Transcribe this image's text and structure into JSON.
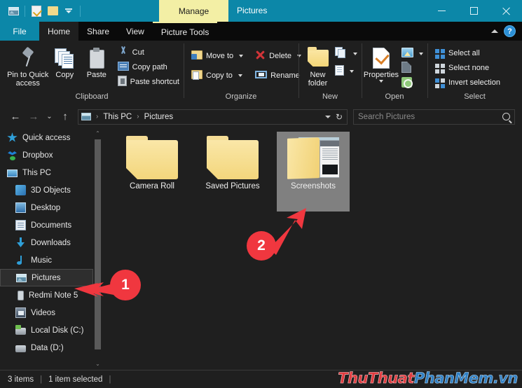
{
  "window": {
    "title": "Pictures",
    "contextual_tab": "Manage",
    "quick_access": [
      {
        "name": "pictures-icon",
        "tooltip": "Pictures"
      },
      {
        "name": "properties-icon",
        "tooltip": "Properties"
      },
      {
        "name": "new-folder-icon",
        "tooltip": "New folder"
      },
      {
        "name": "customize-dropdown-icon",
        "tooltip": "Customize Quick Access Toolbar"
      }
    ],
    "controls": {
      "minimize": "—",
      "maximize": "□",
      "close": "✕"
    },
    "accent_color": "#0c87a8",
    "contextual_color": "#f3efa5",
    "background": "#1f1f1f"
  },
  "tabs": [
    {
      "id": "file",
      "label": "File",
      "state": "file"
    },
    {
      "id": "home",
      "label": "Home",
      "state": "active"
    },
    {
      "id": "share",
      "label": "Share",
      "state": "normal"
    },
    {
      "id": "view",
      "label": "View",
      "state": "normal"
    },
    {
      "id": "picture-tools",
      "label": "Picture Tools",
      "state": "contextual"
    }
  ],
  "tab_strip_right": {
    "collapse_ribbon": "chevron-up-icon",
    "help_label": "?"
  },
  "ribbon": {
    "groups": [
      {
        "id": "clipboard",
        "label": "Clipboard",
        "big_buttons": [
          {
            "id": "pin-to-quick-access",
            "label": "Pin to Quick\naccess",
            "line1": "Pin to Quick",
            "line2": "access",
            "icon": "pin-icon"
          },
          {
            "id": "copy",
            "label": "Copy",
            "line1": "Copy",
            "line2": "",
            "icon": "copy-icon"
          },
          {
            "id": "paste",
            "label": "Paste",
            "line1": "Paste",
            "line2": "",
            "icon": "paste-icon"
          }
        ],
        "small_buttons": [
          {
            "id": "cut",
            "label": "Cut",
            "icon": "scissors-icon"
          },
          {
            "id": "copy-path",
            "label": "Copy path",
            "icon": "copy-path-icon"
          },
          {
            "id": "paste-shortcut",
            "label": "Paste shortcut",
            "icon": "paste-shortcut-icon"
          }
        ]
      },
      {
        "id": "organize",
        "label": "Organize",
        "small_buttons": [
          {
            "id": "move-to",
            "label": "Move to",
            "icon": "move-to-icon",
            "has_caret": true
          },
          {
            "id": "copy-to",
            "label": "Copy to",
            "icon": "copy-to-icon",
            "has_caret": true
          }
        ],
        "small_buttons_2": [
          {
            "id": "delete",
            "label": "Delete",
            "icon": "delete-icon",
            "has_caret": true
          },
          {
            "id": "rename",
            "label": "Rename",
            "icon": "rename-icon",
            "has_caret": false
          }
        ]
      },
      {
        "id": "new",
        "label": "New",
        "big_buttons": [
          {
            "id": "new-folder",
            "label": "New folder",
            "line1": "New",
            "line2": "folder",
            "icon": "new-folder-icon"
          }
        ],
        "small_buttons": [
          {
            "id": "new-item",
            "label": "",
            "icon": "new-item-icon",
            "has_caret": true
          },
          {
            "id": "easy-access",
            "label": "",
            "icon": "easy-access-icon",
            "has_caret": true
          }
        ]
      },
      {
        "id": "open",
        "label": "Open",
        "big_buttons": [
          {
            "id": "properties",
            "label": "Properties",
            "line1": "Properties",
            "line2": "",
            "icon": "properties-icon"
          }
        ],
        "small_buttons": [
          {
            "id": "open-with",
            "label": "",
            "icon": "open-icon",
            "has_caret": true
          },
          {
            "id": "edit",
            "label": "",
            "icon": "edit-icon",
            "has_caret": false
          },
          {
            "id": "history",
            "label": "",
            "icon": "history-icon",
            "has_caret": false
          }
        ]
      },
      {
        "id": "select",
        "label": "Select",
        "small_buttons": [
          {
            "id": "select-all",
            "label": "Select all",
            "icon": "select-all-icon"
          },
          {
            "id": "select-none",
            "label": "Select none",
            "icon": "select-none-icon"
          },
          {
            "id": "invert-selection",
            "label": "Invert selection",
            "icon": "invert-selection-icon"
          }
        ]
      }
    ]
  },
  "address_bar": {
    "back": "←",
    "forward": "→",
    "recent": "⌄",
    "up": "↑",
    "breadcrumbs": [
      {
        "id": "this-pc",
        "label": "This PC"
      },
      {
        "id": "pictures",
        "label": "Pictures"
      }
    ],
    "separator": "›",
    "refresh": "↻",
    "dropdown": "chevron-down-icon"
  },
  "search": {
    "placeholder": "Search Pictures",
    "value": "",
    "icon": "search-icon"
  },
  "nav_pane": {
    "items": [
      {
        "id": "quick-access",
        "label": "Quick access",
        "icon": "star-icon",
        "indent": false,
        "selected": false
      },
      {
        "id": "dropbox",
        "label": "Dropbox",
        "icon": "dropbox-icon",
        "indent": false,
        "selected": false
      },
      {
        "id": "this-pc",
        "label": "This PC",
        "icon": "computer-icon",
        "indent": false,
        "selected": false
      },
      {
        "id": "3d-objects",
        "label": "3D Objects",
        "icon": "3d-objects-icon",
        "indent": true,
        "selected": false
      },
      {
        "id": "desktop",
        "label": "Desktop",
        "icon": "desktop-icon",
        "indent": true,
        "selected": false
      },
      {
        "id": "documents",
        "label": "Documents",
        "icon": "documents-icon",
        "indent": true,
        "selected": false
      },
      {
        "id": "downloads",
        "label": "Downloads",
        "icon": "downloads-icon",
        "indent": true,
        "selected": false
      },
      {
        "id": "music",
        "label": "Music",
        "icon": "music-icon",
        "indent": true,
        "selected": false
      },
      {
        "id": "pictures",
        "label": "Pictures",
        "icon": "pictures-icon",
        "indent": true,
        "selected": true
      },
      {
        "id": "redmi-note-5",
        "label": "Redmi Note 5",
        "icon": "phone-icon",
        "indent": true,
        "selected": false
      },
      {
        "id": "videos",
        "label": "Videos",
        "icon": "videos-icon",
        "indent": true,
        "selected": false
      },
      {
        "id": "local-disk-c",
        "label": "Local Disk (C:)",
        "icon": "system-disk-icon",
        "indent": true,
        "selected": false
      },
      {
        "id": "data-d",
        "label": "Data (D:)",
        "icon": "disk-icon",
        "indent": true,
        "selected": false
      }
    ],
    "scrollbar": {
      "up": "⌃",
      "down": "⌄"
    }
  },
  "content": {
    "items": [
      {
        "id": "camera-roll",
        "label": "Camera Roll",
        "type": "folder",
        "selected": false
      },
      {
        "id": "saved-pictures",
        "label": "Saved Pictures",
        "type": "folder",
        "selected": false
      },
      {
        "id": "screenshots",
        "label": "Screenshots",
        "type": "folder-with-thumbnail",
        "selected": true
      }
    ]
  },
  "annotations": {
    "color": "#f0373f",
    "steps": [
      {
        "id": "step-1",
        "number": "1",
        "target": "nav-pane Pictures"
      },
      {
        "id": "step-2",
        "number": "2",
        "target": "Screenshots folder"
      }
    ]
  },
  "status_bar": {
    "item_count": "3 items",
    "selection": "1 item selected",
    "divider": "|"
  },
  "watermark": {
    "part_red_1": "Thu",
    "part_red_2": "Thuat",
    "part_blue_1": "PhanMem",
    "part_blue_2": ".vn",
    "color_red": "#e03a3e",
    "color_blue": "#2f7fc4"
  }
}
